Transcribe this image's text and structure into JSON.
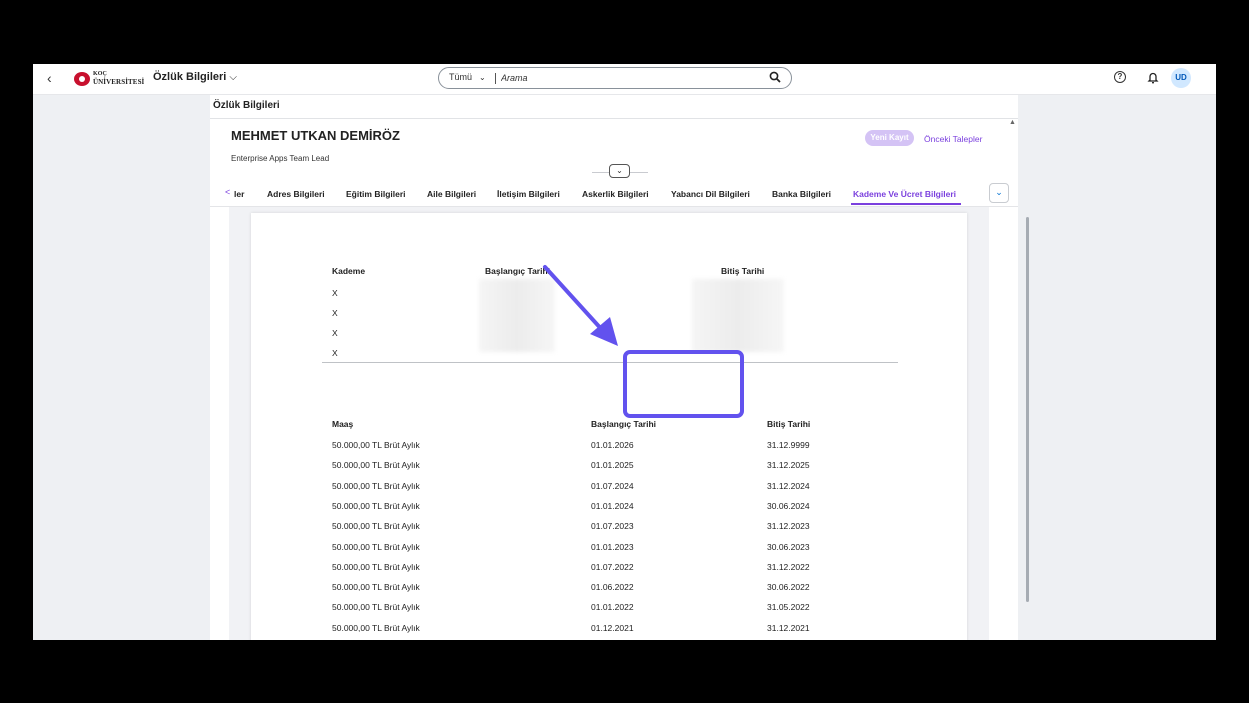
{
  "shell": {
    "back": "‹",
    "logo_line1": "KOÇ",
    "logo_line2": "ÜNİVERSİTESİ",
    "app_title": "Özlük Bilgileri",
    "app_title_chevron": "⌵",
    "search": {
      "scope": "Tümü",
      "scope_chevron": "⌄",
      "placeholder": "Arama"
    },
    "help": "?",
    "avatar": "UD"
  },
  "page": {
    "title": "Özlük Bilgileri",
    "employee_name": "MEHMET UTKAN DEMİRÖZ",
    "employee_role": "Enterprise Apps Team Lead",
    "new_record_button": "Yeni Kayıt",
    "previous_requests_link": "Önceki Talepler",
    "collapse_chevron": "⌄",
    "tab_prev": "<",
    "tabs": [
      {
        "label": "ler"
      },
      {
        "label": "Adres Bilgileri"
      },
      {
        "label": "Eğitim Bilgileri"
      },
      {
        "label": "Aile Bilgileri"
      },
      {
        "label": "İletişim Bilgileri"
      },
      {
        "label": "Askerlik Bilgileri"
      },
      {
        "label": "Yabancı Dil Bilgileri"
      },
      {
        "label": "Banka Bilgileri"
      },
      {
        "label": "Kademe Ve Ücret Bilgileri"
      }
    ],
    "active_tab": "Kademe Ve Ücret Bilgileri",
    "tab_overflow": "⌄"
  },
  "kademe_table": {
    "headers": {
      "kademe": "Kademe",
      "start": "Başlangıç Tarihi",
      "end": "Bitiş Tarihi"
    },
    "rows": [
      "X",
      "X",
      "X",
      "X"
    ]
  },
  "maas_table": {
    "headers": {
      "salary": "Maaş",
      "start": "Başlangıç Tarihi",
      "end": "Bitiş Tarihi"
    },
    "rows": [
      {
        "salary": "50.000,00 TL Brüt Aylık",
        "start": "01.01.2026",
        "end": "31.12.9999"
      },
      {
        "salary": "50.000,00 TL Brüt Aylık",
        "start": "01.01.2025",
        "end": "31.12.2025"
      },
      {
        "salary": "50.000,00 TL Brüt Aylık",
        "start": "01.07.2024",
        "end": "31.12.2024"
      },
      {
        "salary": "50.000,00 TL Brüt Aylık",
        "start": "01.01.2024",
        "end": "30.06.2024"
      },
      {
        "salary": "50.000,00 TL Brüt Aylık",
        "start": "01.07.2023",
        "end": "31.12.2023"
      },
      {
        "salary": "50.000,00 TL Brüt Aylık",
        "start": "01.01.2023",
        "end": "30.06.2023"
      },
      {
        "salary": "50.000,00 TL Brüt Aylık",
        "start": "01.07.2022",
        "end": "31.12.2022"
      },
      {
        "salary": "50.000,00 TL Brüt Aylık",
        "start": "01.06.2022",
        "end": "30.06.2022"
      },
      {
        "salary": "50.000,00 TL Brüt Aylık",
        "start": "01.01.2022",
        "end": "31.05.2022"
      },
      {
        "salary": "50.000,00 TL Brüt Aylık",
        "start": "01.12.2021",
        "end": "31.12.2021"
      }
    ]
  },
  "colors": {
    "accent": "#7b40de",
    "annotation": "#6252ee",
    "avatar_bg": "#d1e8ff",
    "brand": "#c8102e"
  }
}
